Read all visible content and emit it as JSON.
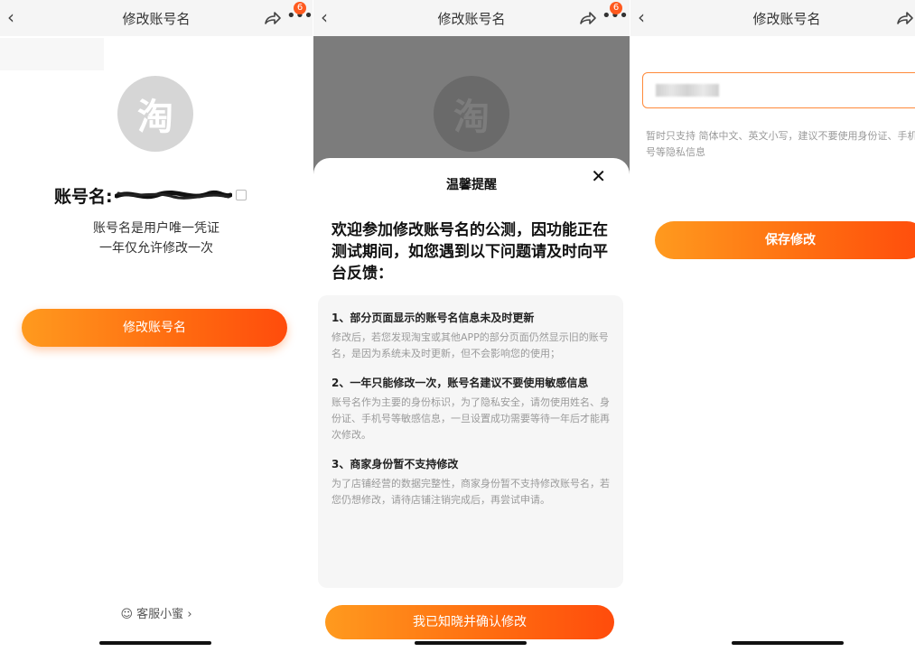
{
  "screens": [
    {
      "topbar": {
        "title": "修改账号名",
        "badge": "6"
      },
      "avatar_glyph": "淘",
      "account_label": "账号名:",
      "info_lines": [
        "账号名是用户唯一凭证",
        "一年仅允许修改一次"
      ],
      "button_label": "修改账号名",
      "service_label": "客服小蜜"
    },
    {
      "topbar": {
        "title": "修改账号名",
        "badge": "6"
      },
      "avatar_glyph": "淘",
      "dialog": {
        "title": "温馨提醒",
        "heading": "欢迎参加修改账号名的公测，因功能正在测试期间，如您遇到以下问题请及时向平台反馈：",
        "items": [
          {
            "title": "1、部分页面显示的账号名信息未及时更新",
            "body": "修改后，若您发现淘宝或其他APP的部分页面仍然显示旧的账号名，是因为系统未及时更新，但不会影响您的使用；"
          },
          {
            "title": "2、一年只能修改一次，账号名建议不要使用敏感信息",
            "body": "账号名作为主要的身份标识，为了隐私安全，请勿使用姓名、身份证、手机号等敏感信息，一旦设置成功需要等待一年后才能再次修改。"
          },
          {
            "title": "3、商家身份暂不支持修改",
            "body": "为了店铺经营的数据完整性，商家身份暂不支持修改账号名，若您仍想修改，请待店铺注销完成后，再尝试申请。"
          }
        ],
        "confirm_label": "我已知晓并确认修改"
      }
    },
    {
      "topbar": {
        "title": "修改账号名"
      },
      "hint": "暂时只支持 简体中文、英文小写，建议不要使用身份证、手机号等隐私信息",
      "save_label": "保存修改"
    }
  ],
  "colors": {
    "accent": "#ff6a10",
    "accent_start": "#ff9a1e",
    "badge": "#ff5a1f",
    "input_border": "#ff8a3a"
  },
  "icons": [
    "back-arrow-icon",
    "share-icon",
    "more-dots-icon",
    "copy-icon",
    "close-icon",
    "service-bee-icon",
    "chevron-right-icon"
  ]
}
